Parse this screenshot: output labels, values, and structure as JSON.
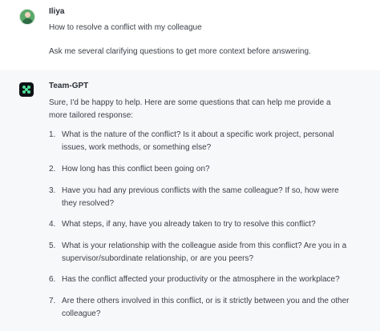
{
  "user_message": {
    "name": "Iliya",
    "text_line1": "How to resolve a conflict with my colleague",
    "text_line2": "Ask me several clarifying questions to get more context before answering."
  },
  "assistant_message": {
    "name": "Team-GPT",
    "intro": "Sure, I'd be happy to help. Here are some questions that can help me provide a more tailored response:",
    "questions": [
      {
        "num": "1.",
        "text": "What is the nature of the conflict? Is it about a specific work project, personal issues, work methods, or something else?"
      },
      {
        "num": "2.",
        "text": "How long has this conflict been going on?"
      },
      {
        "num": "3.",
        "text": "Have you had any previous conflicts with the same colleague? If so, how were they resolved?"
      },
      {
        "num": "4.",
        "text": "What steps, if any, have you already taken to try to resolve this conflict?"
      },
      {
        "num": "5.",
        "text": "What is your relationship with the colleague aside from this conflict? Are you in a supervisor/subordinate relationship, or are you peers?"
      },
      {
        "num": "6.",
        "text": "Has the conflict affected your productivity or the atmosphere in the workplace?"
      },
      {
        "num": "7.",
        "text": "Are there others involved in this conflict, or is it strictly between you and the other colleague?"
      }
    ]
  }
}
